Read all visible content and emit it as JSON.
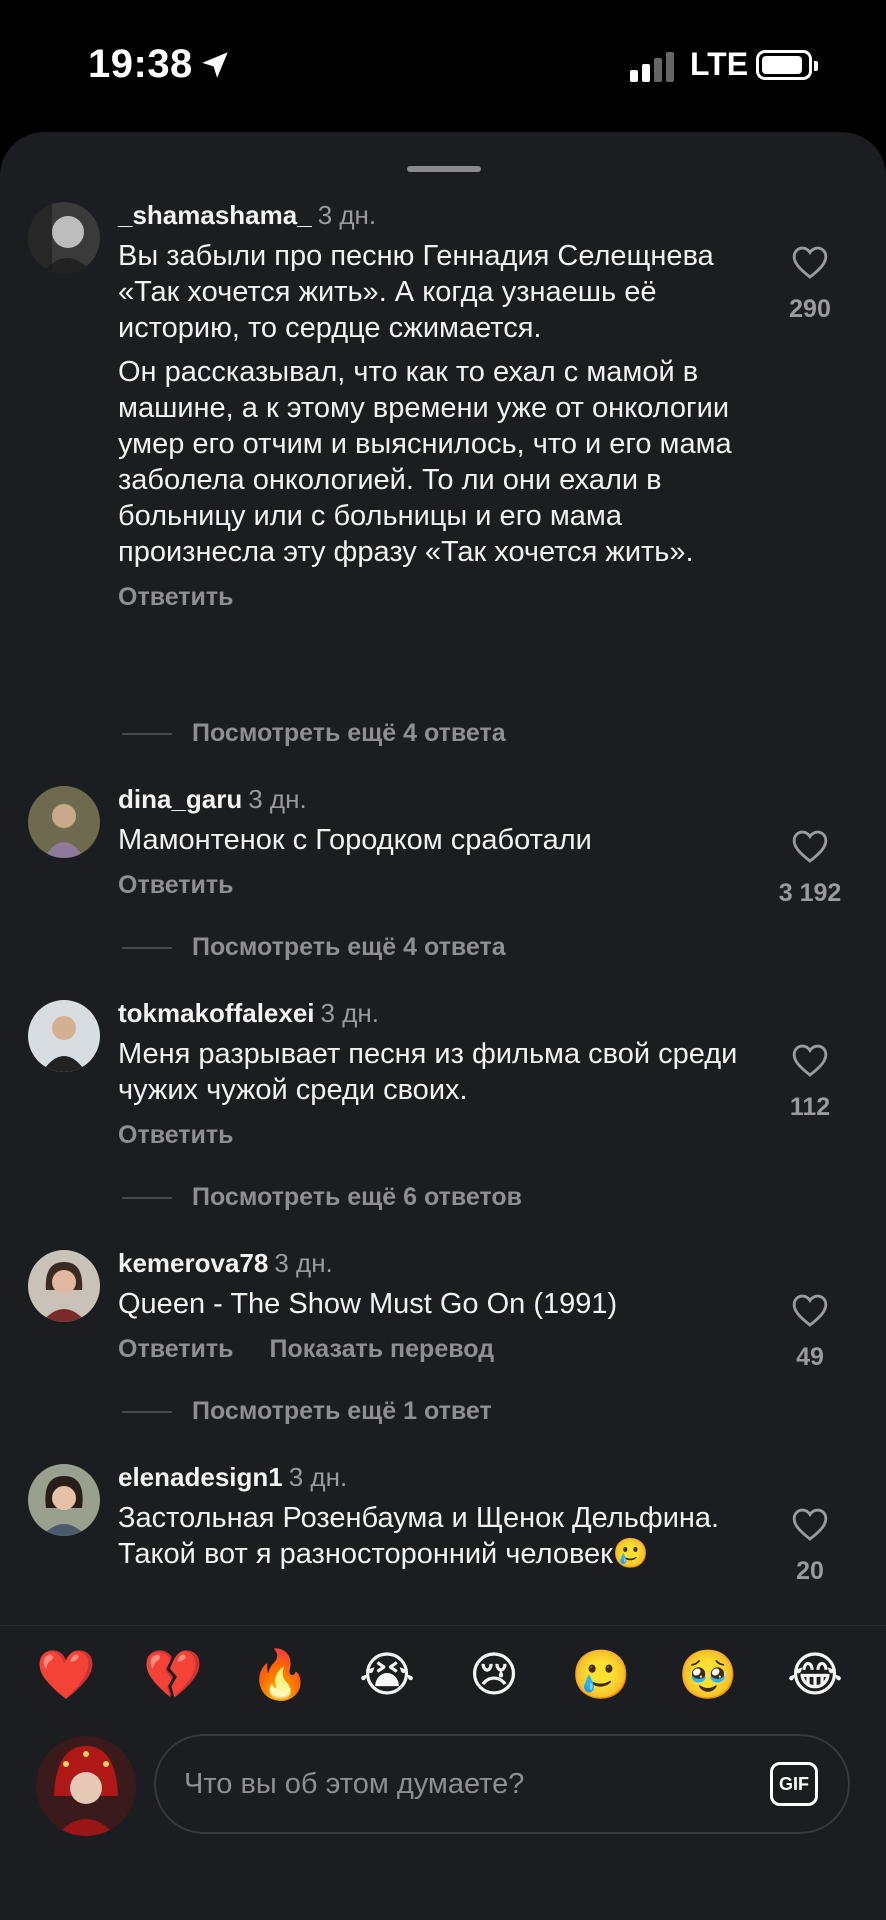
{
  "status_bar": {
    "time": "19:38",
    "network": "LTE"
  },
  "comments": [
    {
      "username": "_shamashama_",
      "time": "3 дн.",
      "paragraphs": [
        "Вы забыли про песню Геннадия Селещнева «Так хочется жить». А когда узнаешь её историю, то сердце сжимается.",
        "Он рассказывал, что как то ехал с мамой в машине, а к этому времени уже от онкологии умер его отчим и выяснилось, что и его мама заболела онкологией. То ли они ехали в больницу или с больницы и его мама произнесла эту фразу «Так хочется жить»."
      ],
      "reply": "Ответить",
      "likes": "290",
      "more_replies": "Посмотреть ещё 4 ответа"
    },
    {
      "username": "dina_garu",
      "time": "3 дн.",
      "paragraphs": [
        "Мамонтенок с Городком сработали"
      ],
      "reply": "Ответить",
      "likes": "3 192",
      "more_replies": "Посмотреть ещё 4 ответа"
    },
    {
      "username": "tokmakoffalexei",
      "time": "3 дн.",
      "paragraphs": [
        "Меня разрывает песня из фильма свой среди чужих чужой среди своих."
      ],
      "reply": "Ответить",
      "likes": "112",
      "more_replies": "Посмотреть ещё 6 ответов"
    },
    {
      "username": "kemerova78",
      "time": "3 дн.",
      "paragraphs": [
        "Queen - The Show Must Go On (1991)"
      ],
      "reply": "Ответить",
      "translate": "Показать перевод",
      "likes": "49",
      "more_replies": "Посмотреть ещё 1 ответ"
    },
    {
      "username": "elenadesign1",
      "time": "3 дн.",
      "paragraphs": [
        "Застольная Розенбаума и Щенок Дельфина. Такой вот я разносторонний человек🥲"
      ],
      "likes": "20"
    }
  ],
  "reactions": [
    "❤️",
    "💔",
    "🔥",
    "😭",
    "😢",
    "🥲",
    "🥹",
    "😂"
  ],
  "input": {
    "placeholder": "Что вы об этом думаете?",
    "gif_label": "GIF"
  },
  "colors": {
    "background": "#1c1d20",
    "secondary_text": "#8e8e93",
    "heart_outline": "#9a9a9f"
  }
}
